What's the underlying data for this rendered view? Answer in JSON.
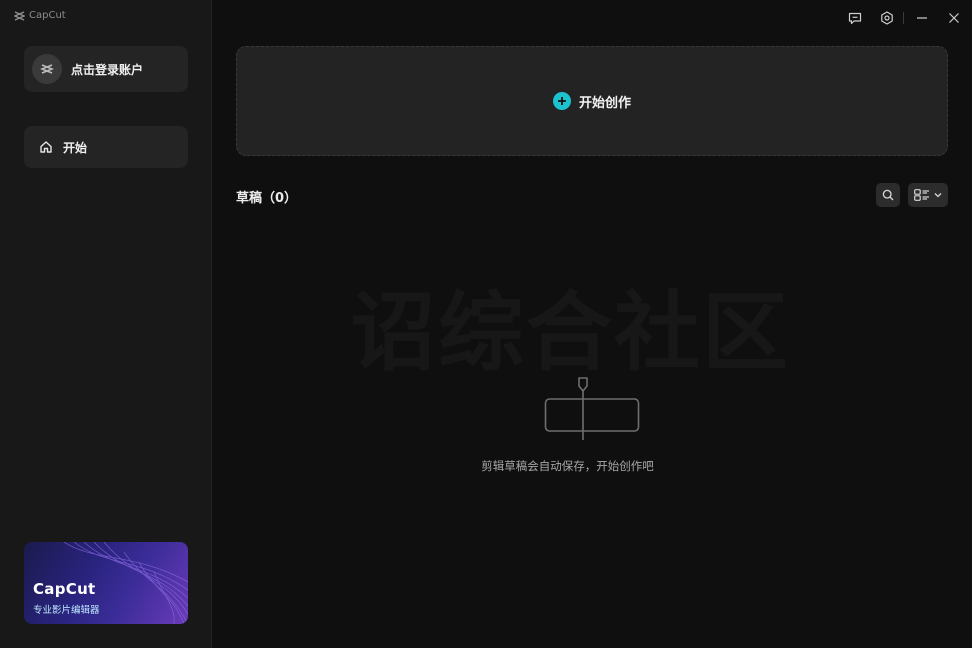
{
  "app": {
    "brand_name": "CapCut"
  },
  "sidebar": {
    "login_label": "点击登录账户",
    "nav_items": [
      {
        "label": "开始",
        "icon": "home-icon"
      }
    ],
    "promo": {
      "title": "CapCut",
      "subtitle": "专业影片编辑器"
    }
  },
  "topbar": {
    "icons": [
      "feedback-icon",
      "settings-icon",
      "minimize-icon",
      "close-icon"
    ]
  },
  "main": {
    "create_label": "开始创作",
    "drafts_title": "草稿（0）",
    "empty_message": "剪辑草稿会自动保存，开始创作吧",
    "watermark": "诏综合社区"
  },
  "colors": {
    "accent": "#1cc3cf",
    "background": "#0f0f0f",
    "sidebar": "#181818",
    "card": "#242424"
  }
}
